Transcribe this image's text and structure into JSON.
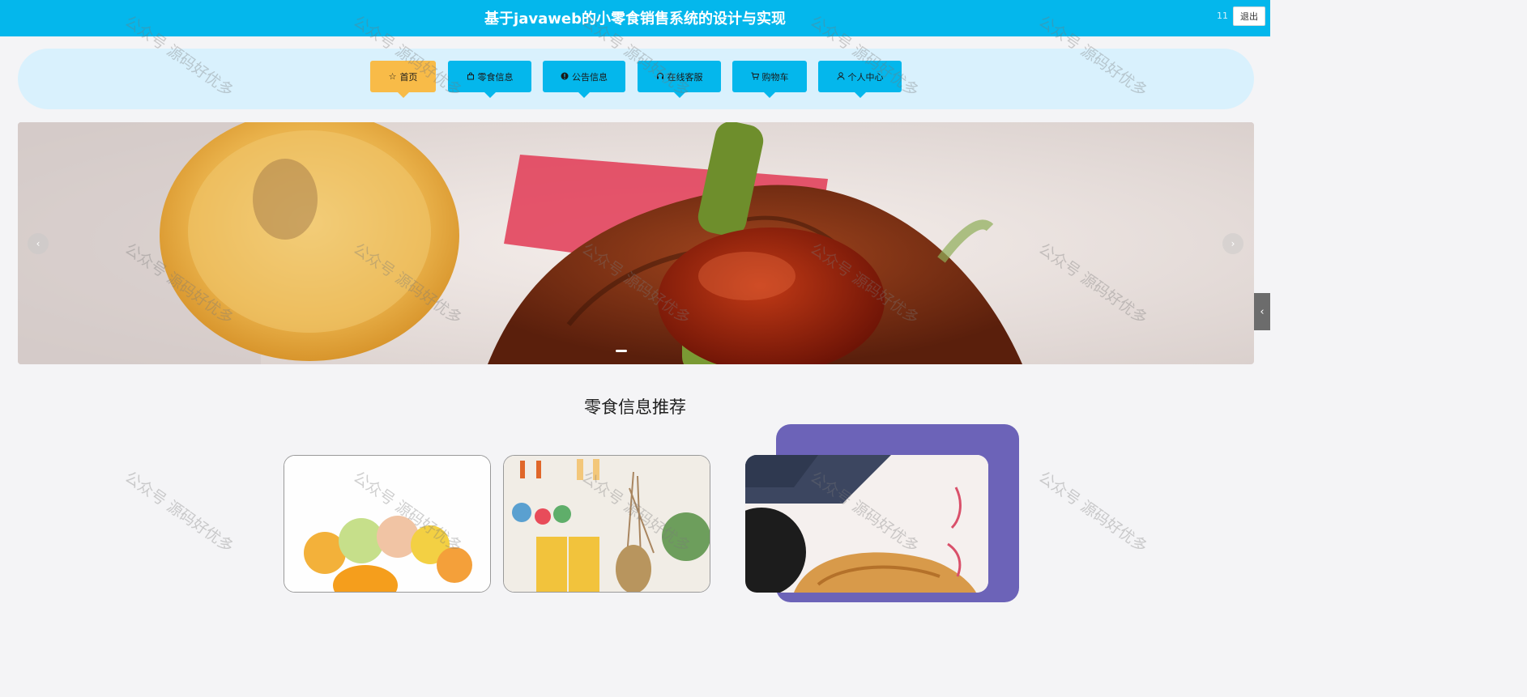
{
  "header": {
    "title": "基于javaweb的小零食销售系统的设计与实现",
    "user": "11",
    "logout_label": "退出"
  },
  "nav": {
    "items": [
      {
        "label": "首页",
        "icon": "star-icon",
        "active": true
      },
      {
        "label": "零食信息",
        "icon": "bag-icon",
        "active": false
      },
      {
        "label": "公告信息",
        "icon": "info-icon",
        "active": false
      },
      {
        "label": "在线客服",
        "icon": "headset-icon",
        "active": false
      },
      {
        "label": "购物车",
        "icon": "cart-icon",
        "active": false
      },
      {
        "label": "个人中心",
        "icon": "user-icon",
        "active": false
      }
    ]
  },
  "carousel": {
    "prev_icon": "chevron-left-icon",
    "next_icon": "chevron-right-icon",
    "active_slide": 1,
    "slide_count": 3
  },
  "side_tab": {
    "icon": "chevron-left-icon"
  },
  "recommend": {
    "title": "零食信息推荐"
  },
  "watermark": "公众号 源码好优多",
  "colors": {
    "header_bg": "#04b7ec",
    "nav_strip_bg": "#d9f1fd",
    "nav_button": "#04b7ec",
    "nav_active": "#f8bb48",
    "feature_card_back": "#6c63b8"
  }
}
